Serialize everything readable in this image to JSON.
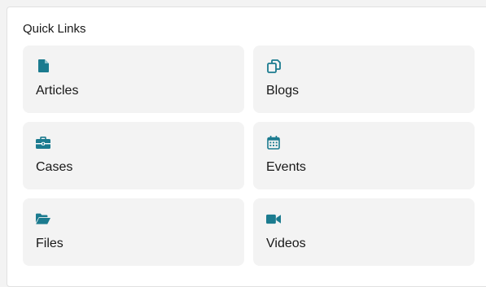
{
  "panel": {
    "title": "Quick Links"
  },
  "accent_color": "#1b7b8f",
  "tiles": [
    {
      "label": "Articles",
      "icon": "document-icon"
    },
    {
      "label": "Blogs",
      "icon": "copy-icon"
    },
    {
      "label": "Cases",
      "icon": "briefcase-icon"
    },
    {
      "label": "Events",
      "icon": "calendar-icon"
    },
    {
      "label": "Files",
      "icon": "folder-open-icon"
    },
    {
      "label": "Videos",
      "icon": "video-camera-icon"
    }
  ]
}
